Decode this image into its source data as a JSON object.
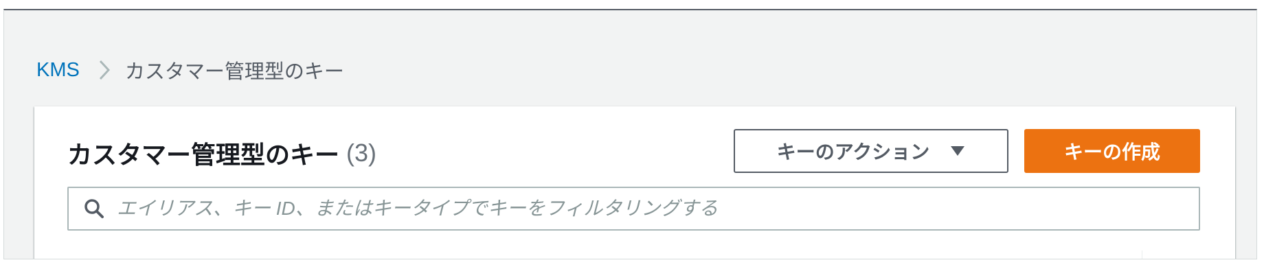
{
  "breadcrumb": {
    "root": "KMS",
    "current": "カスタマー管理型のキー"
  },
  "panel": {
    "title": "カスタマー管理型のキー",
    "count": "(3)",
    "actions_label": "キーのアクション",
    "create_label": "キーの作成"
  },
  "search": {
    "value": "",
    "placeholder": "エイリアス、キー ID、またはキータイプでキーをフィルタリングする"
  },
  "icons": {
    "breadcrumb_separator": "chevron-right-icon",
    "actions_caret": "caret-down-icon",
    "search": "search-icon"
  },
  "colors": {
    "link": "#0073bb",
    "primary_button": "#ec7211",
    "text": "#16191f",
    "muted": "#687078"
  }
}
